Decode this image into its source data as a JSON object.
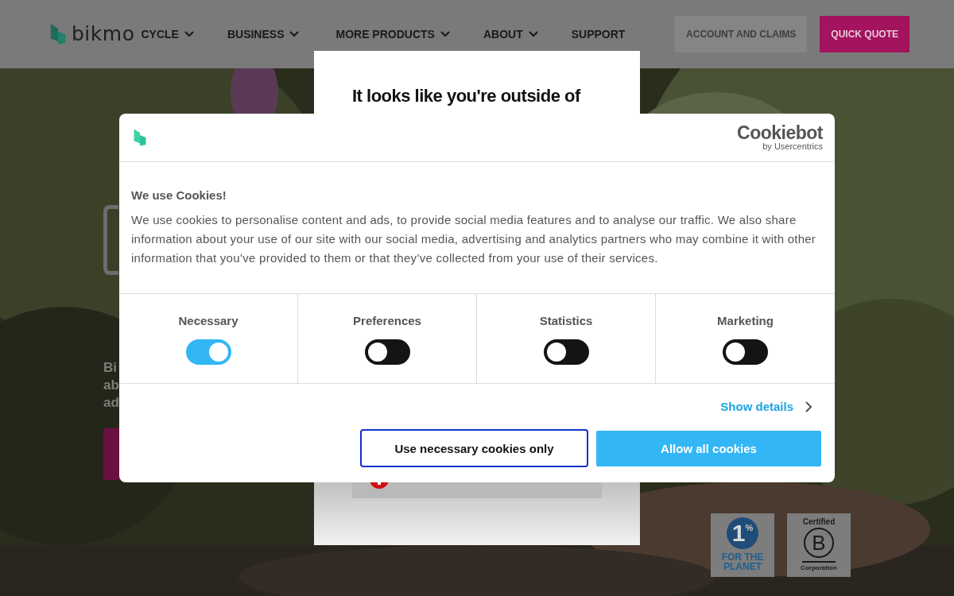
{
  "header": {
    "logo_text": "bikmo",
    "nav": [
      {
        "label": "CYCLE",
        "has_dropdown": true
      },
      {
        "label": "BUSINESS",
        "has_dropdown": true
      },
      {
        "label": "MORE PRODUCTS",
        "has_dropdown": true
      },
      {
        "label": "ABOUT",
        "has_dropdown": true
      },
      {
        "label": "SUPPORT",
        "has_dropdown": false
      }
    ],
    "buttons": [
      {
        "label": "ACCOUNT AND CLAIMS",
        "kind": "secondary"
      },
      {
        "label": "QUICK QUOTE",
        "kind": "primary"
      }
    ]
  },
  "hero": {
    "text_fragments": [
      "Bi",
      "ab",
      "ad"
    ]
  },
  "location_modal": {
    "heading": "It looks like you're outside of"
  },
  "badges": [
    {
      "kind": "one-percent",
      "mark": "1",
      "sign": "%",
      "lines": [
        "FOR THE",
        "PLANET"
      ]
    },
    {
      "kind": "b-corp",
      "top": "Certified",
      "mark": "B",
      "bottom": "Corporation"
    }
  ],
  "cookie_dialog": {
    "brand": "Cookiebot",
    "brand_sub": "by Usercentrics",
    "title": "We use Cookies!",
    "text": "We use cookies to personalise content and ads, to provide social media features and to analyse our traffic. We also share information about your use of our site with our social media, advertising and analytics partners who may combine it with other information that you’ve provided to them or that they’ve collected from your use of their services.",
    "categories": [
      {
        "label": "Necessary",
        "on": true
      },
      {
        "label": "Preferences",
        "on": false
      },
      {
        "label": "Statistics",
        "on": false
      },
      {
        "label": "Marketing",
        "on": false
      }
    ],
    "show_details": "Show details",
    "buttons": [
      {
        "label": "Use necessary cookies only",
        "kind": "outline"
      },
      {
        "label": "Allow all cookies",
        "kind": "filled"
      }
    ]
  }
}
